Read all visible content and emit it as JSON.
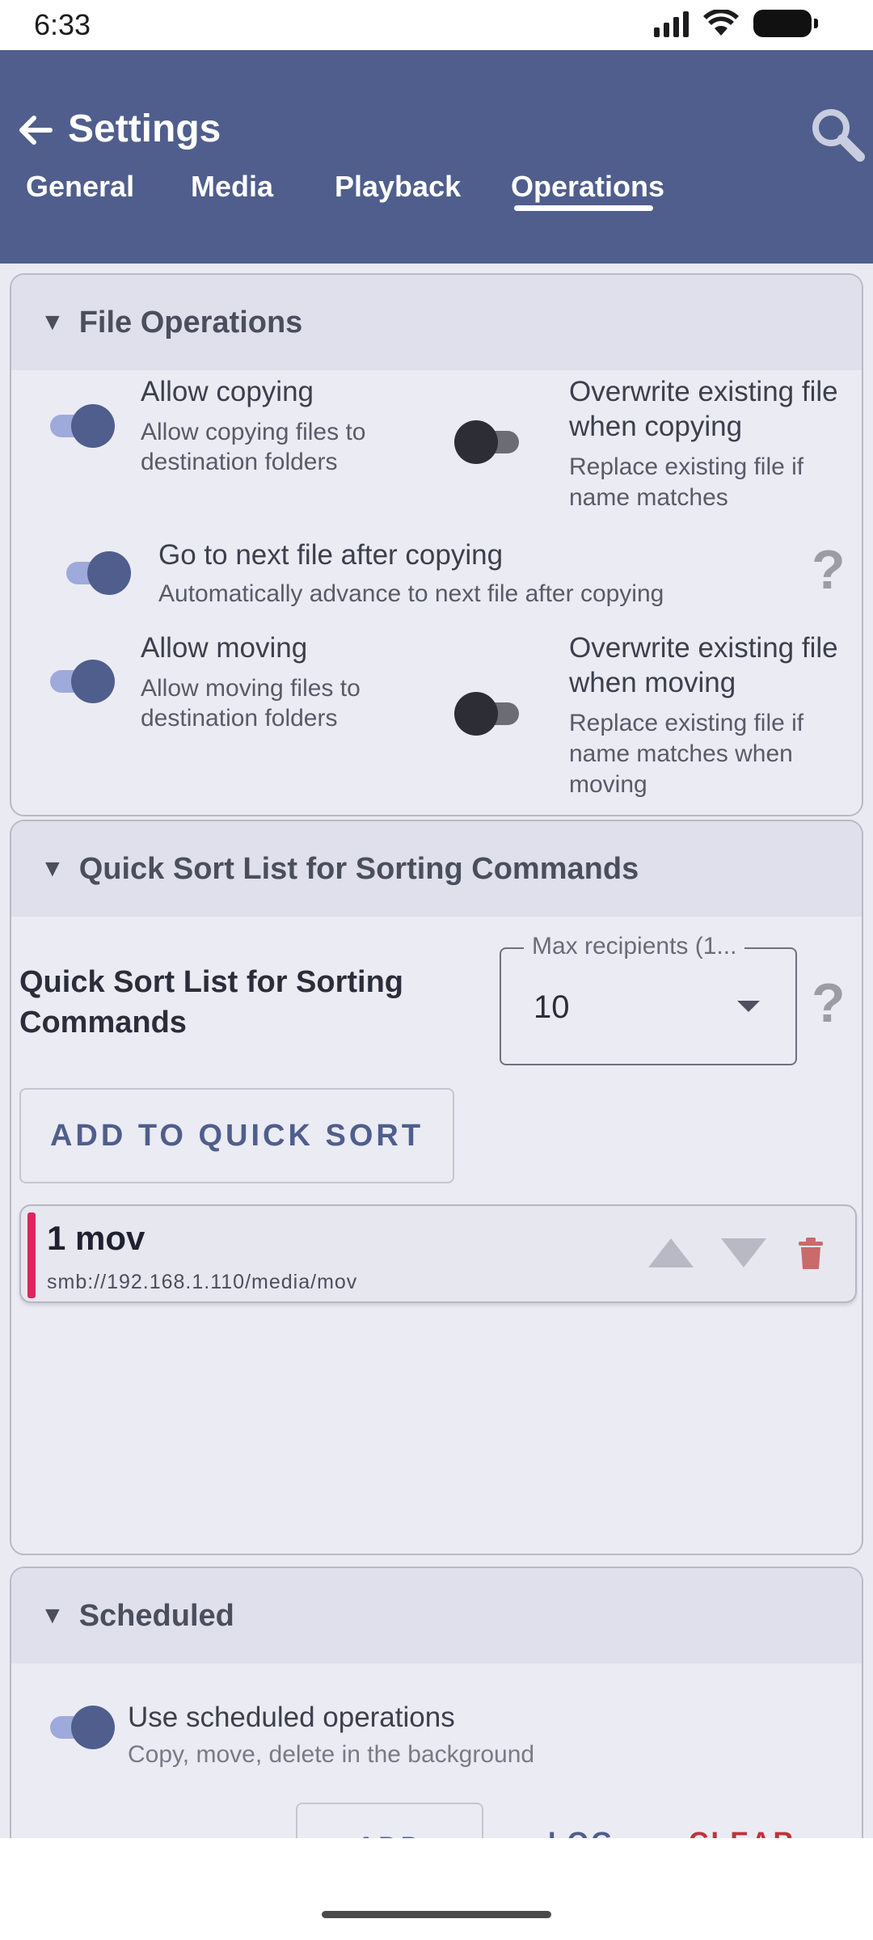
{
  "status_bar": {
    "time": "6:33"
  },
  "app_bar": {
    "title": "Settings",
    "tabs": [
      {
        "label": "General"
      },
      {
        "label": "Media"
      },
      {
        "label": "Playback"
      },
      {
        "label": "Operations"
      }
    ],
    "active_tab": "Operations"
  },
  "file_operations": {
    "header": "File Operations",
    "allow_copying": {
      "title": "Allow copying",
      "desc_line1": "Allow copying files to",
      "desc_line2": "destination folders",
      "enabled": true
    },
    "overwrite_copying": {
      "title_line1": "Overwrite existing file",
      "title_line2": "when copying",
      "desc_line1": "Replace existing file if",
      "desc_line2": "name matches",
      "enabled": false
    },
    "next_after_copy": {
      "title": "Go to next file after copying",
      "desc": "Automatically advance to next file after copying",
      "enabled": true
    },
    "allow_moving": {
      "title": "Allow moving",
      "desc_line1": "Allow moving files to",
      "desc_line2": "destination folders",
      "enabled": true
    },
    "overwrite_moving": {
      "title_line1": "Overwrite existing file",
      "title_line2": "when moving",
      "desc_line1": "Replace existing file if",
      "desc_line2": "name matches when",
      "desc_line3": "moving",
      "enabled": false
    }
  },
  "quick_sort": {
    "header": "Quick Sort List for Sorting Commands",
    "label_line1": "Quick Sort List for Sorting",
    "label_line2": "Commands",
    "max_recipients_label": "Max recipients (1...",
    "max_recipients_value": "10",
    "add_button": "ADD TO QUICK SORT",
    "items": [
      {
        "name": "1 mov",
        "path": "smb://192.168.1.110/media/mov"
      }
    ]
  },
  "scheduled": {
    "header": "Scheduled",
    "use_scheduled": {
      "title": "Use scheduled operations",
      "desc": "Copy, move, delete in the background",
      "enabled": true
    },
    "buttons": {
      "add": "ADD",
      "log": "LOG",
      "clear_all": "CLEAR ALL"
    }
  },
  "colors": {
    "primary": "#4f5e8c",
    "danger": "#c0323a",
    "accent_bar": "#e0245e"
  }
}
